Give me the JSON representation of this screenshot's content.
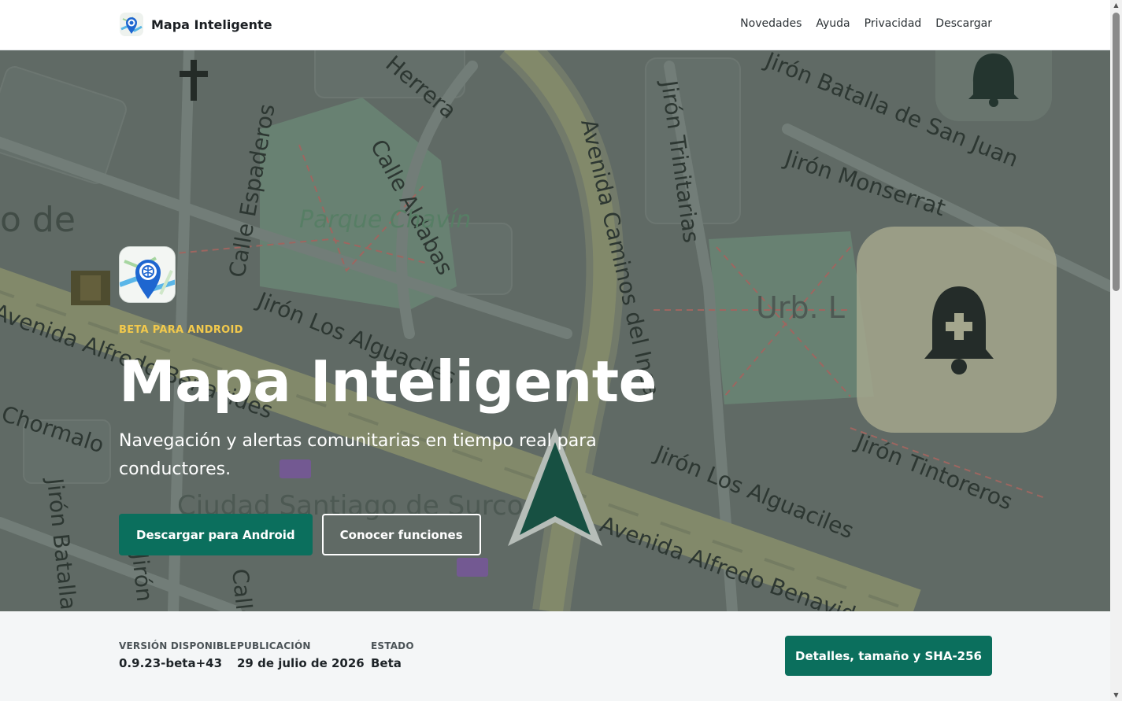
{
  "header": {
    "brand_name": "Mapa Inteligente",
    "nav": [
      "Novedades",
      "Ayuda",
      "Privacidad",
      "Descargar"
    ]
  },
  "hero": {
    "eyebrow": "BETA PARA ANDROID",
    "title": "Mapa Inteligente",
    "subtitle": "Navegación y alertas comunitarias en tiempo real para conductores.",
    "primary_cta": "Descargar para Android",
    "secondary_cta": "Conocer funciones",
    "map_labels": {
      "street_1": "Herrera",
      "street_2": "Calle Espaderos",
      "street_3": "Calle Aldabas",
      "street_4": "Avenida Caminos del Inca",
      "street_5": "Jirón Trinitarias",
      "street_6": "Jirón Batalla de San Juan",
      "street_7": "Jirón Monserrat",
      "street_8": "Jirón Los Alguaciles",
      "street_9": "Jirón Los Alguaciles",
      "street_10": "Jirón Tintoreros",
      "street_11": "Avenida Alfredo Benavides",
      "street_12": "Avenida Alfredo Benavides",
      "street_13": "Chormalo",
      "street_14": "Jirón Batalla",
      "street_15": "Jirón",
      "street_16": "Calle",
      "park": "Parque Chavín",
      "district_1": "Urb. L",
      "district_2": "Ciudad Santiago de Surco",
      "place_fragment": "o de"
    },
    "colors": {
      "accent": "#0b6f5d",
      "eyebrow": "#f2c94c",
      "overlay": "#4f5a55"
    }
  },
  "info": {
    "version_label": "VERSIÓN DISPONIBLE",
    "version_value": "0.9.23-beta+43",
    "published_label": "PUBLICACIÓN",
    "published_value": "29 de julio de 2026",
    "status_label": "ESTADO",
    "status_value": "Beta",
    "details_button": "Detalles, tamaño y SHA-256"
  }
}
